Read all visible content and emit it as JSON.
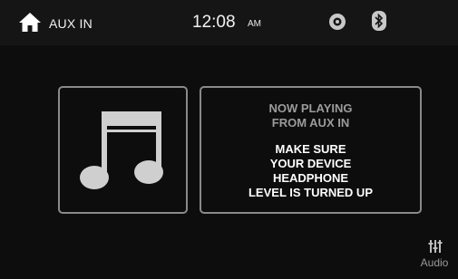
{
  "status_bar": {
    "source": "AUX IN",
    "time": "12:08",
    "time_suffix": "AM",
    "home_icon": "home-icon",
    "settings_icon": "gear-icon",
    "bluetooth_icon": "bluetooth-icon"
  },
  "album_art": {
    "icon": "music-note-icon"
  },
  "info": {
    "header": [
      "NOW PLAYING",
      "FROM AUX IN"
    ],
    "message": [
      "MAKE SURE",
      "YOUR DEVICE",
      "HEADPHONE",
      "LEVEL IS TURNED UP"
    ]
  },
  "audio_button": {
    "label": "Audio",
    "icon": "equalizer-sliders-icon"
  },
  "colors": {
    "background": "#0d0d0d",
    "border": "#8a8a8a",
    "muted_text": "#9b9b9b",
    "primary_text": "#ffffff"
  }
}
